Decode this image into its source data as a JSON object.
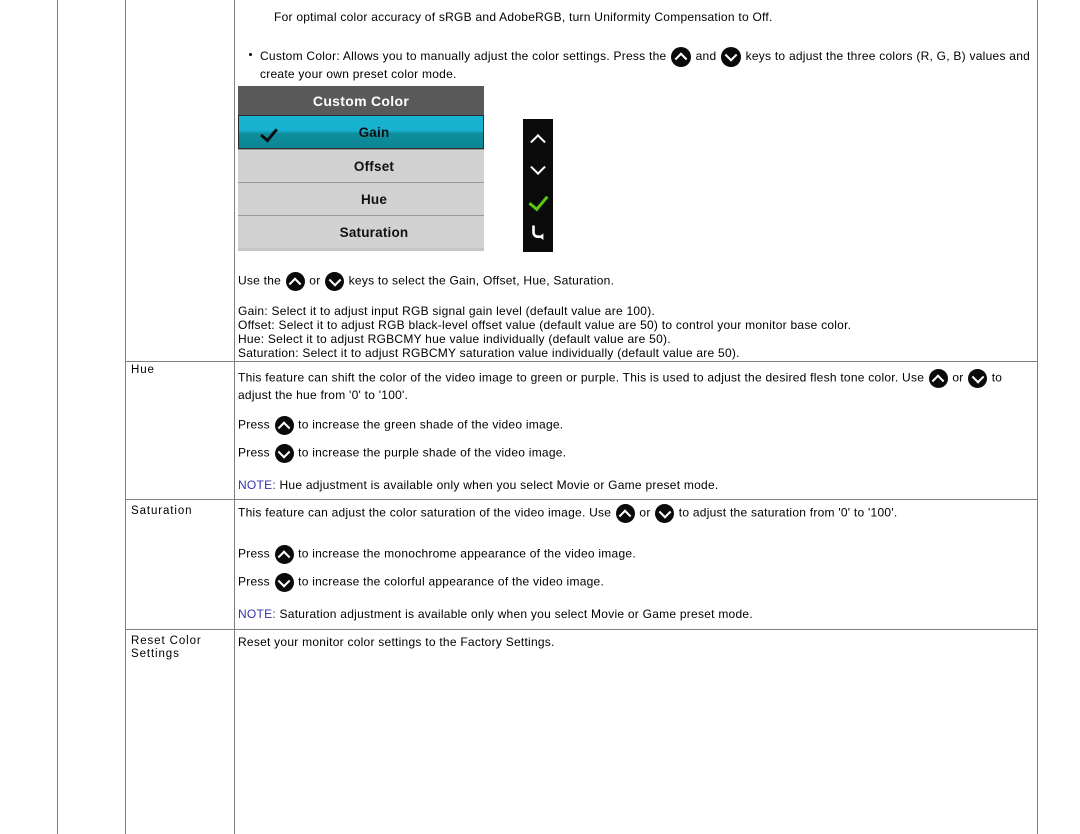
{
  "intro": {
    "optimal_note": "For optimal color accuracy of sRGB and AdobeRGB, turn Uniformity Compensation to Off.",
    "bullet_part1": "Custom Color: Allows you to manually adjust the color settings. Press the",
    "bullet_and": "and",
    "bullet_part2": "keys to adjust the three colors (R, G, B) values and create your own preset color mode."
  },
  "osd": {
    "title": "Custom Color",
    "items": [
      {
        "label": "Gain",
        "selected": true,
        "checked": true
      },
      {
        "label": "Offset",
        "selected": false,
        "checked": false
      },
      {
        "label": "Hue",
        "selected": false,
        "checked": false
      },
      {
        "label": "Saturation",
        "selected": false,
        "checked": false
      }
    ],
    "strip_buttons": [
      "up-chevron-icon",
      "down-chevron-icon",
      "green-check-icon",
      "back-arrow-icon"
    ]
  },
  "custom_color_body": {
    "use_keys_part1": "Use the",
    "use_keys_or": "or",
    "use_keys_part2": "keys to select the Gain, Offset, Hue, Saturation.",
    "definitions": [
      "Gain: Select it to adjust input RGB signal gain level (default value are 100).",
      "Offset: Select it to adjust RGB black-level offset value (default value are 50) to control your monitor base color.",
      "Hue: Select it to adjust RGBCMY hue value individually (default value are 50).",
      "Saturation: Select it to adjust RGBCMY saturation value individually (default value are 50)."
    ]
  },
  "rows": {
    "hue": {
      "label": "Hue",
      "desc_part1": "This feature can shift the color of the video image to green or purple. This is used to adjust the desired flesh tone color. Use",
      "desc_or": "or",
      "desc_part2": "to adjust the hue from '0' to '100'.",
      "press_up_pre": "Press",
      "press_up_post": "to increase the green shade of the video image.",
      "press_down_pre": "Press",
      "press_down_post": "to increase the purple shade of the video image.",
      "note_label": "NOTE:",
      "note_text": "Hue adjustment is available only when you select Movie or Game preset mode."
    },
    "saturation": {
      "label": "Saturation",
      "desc_part1": "This feature can adjust the color saturation of the video image. Use",
      "desc_or": "or",
      "desc_part2": "to adjust the saturation from '0' to '100'.",
      "press_up_pre": "Press",
      "press_up_post": "to increase the monochrome appearance of the video image.",
      "press_down_pre": "Press",
      "press_down_post": "to increase the colorful appearance of the video image.",
      "note_label": "NOTE:",
      "note_text": "Saturation adjustment is available only when you select Movie or Game preset mode."
    },
    "reset": {
      "label": "Reset Color Settings",
      "desc": "Reset your monitor color settings to the Factory Settings."
    }
  },
  "colors": {
    "osd_header_bg": "#595959",
    "osd_row_bg": "#d2d2d2",
    "osd_selected_top": "#17b3d0",
    "osd_selected_bottom": "#0b8694",
    "note_blue": "#3333aa",
    "check_green": "#5ac814",
    "border_gray": "#808080"
  }
}
